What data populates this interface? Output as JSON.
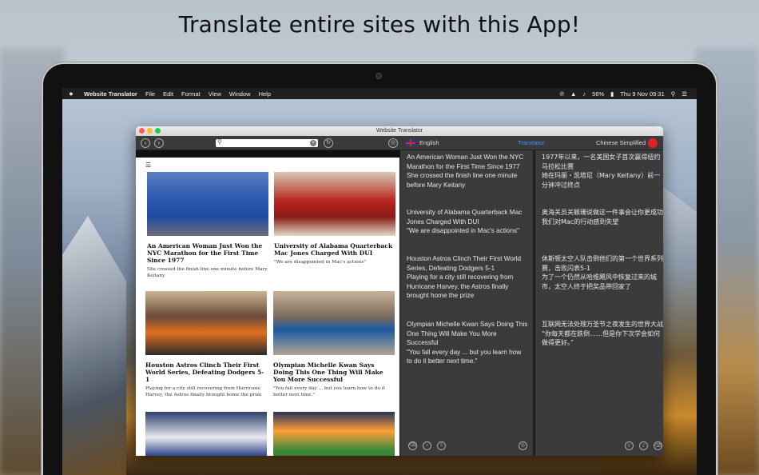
{
  "headline": "Translate entire sites with this App!",
  "menubar": {
    "apple": "",
    "app_name": "Website Translator",
    "items": [
      "File",
      "Edit",
      "Format",
      "View",
      "Window",
      "Help"
    ],
    "battery": "56%",
    "datetime": "Thu 9 Nov  09:31"
  },
  "window": {
    "title": "Website Translator",
    "source_language": "English",
    "translator_label": "Translator",
    "target_language": "Chinese Simplified",
    "search_placeholder": ""
  },
  "browser": {
    "articles": [
      {
        "title": "An American Woman Just Won the NYC Marathon for the First Time Since 1977",
        "snippet": "She crossed the finish line one minute before Mary Keitany"
      },
      {
        "title": "University of Alabama Quarterback Mac Jones Charged With DUI",
        "snippet": "\"We are disappointed in Mac's actions\""
      },
      {
        "title": "Houston Astros Clinch Their First World Series, Defeating Dodgers 5-1",
        "snippet": "Playing for a city still recovering from Hurricane Harvey, the Astros finally brought home the prize"
      },
      {
        "title": "Olympian Michelle Kwan Says Doing This One Thing Will Make You More Successful",
        "snippet": "\"You fall every day ... but you learn how to do it better next time.\""
      }
    ]
  },
  "source_pane": {
    "paragraphs": [
      "An American Woman Just Won the NYC Marathon for the First Time Since 1977\nShe crossed the finish line one minute before Mary Keitany",
      "University of Alabama Quarterback Mac Jones Charged With DUI\n\"We are disappointed in Mac's actions\"",
      "Houston Astros Clinch Their First World Series, Defeating Dodgers 5-1\nPlaying for a city still recovering from Hurricane Harvey, the Astros finally brought home the prize",
      "Olympian Michelle Kwan Says Doing This One Thing Will Make You More Successful\n\"You fall every day ... but you learn how to do it better next time.\""
    ]
  },
  "target_pane": {
    "paragraphs": [
      "1977年以来，一名美国女子首次赢得纽约马拉松比赛\n她在玛丽・凯塔尼（Mary Keitany）前一分钟冲过终点",
      "奥海关员关颖珊说做这一件事会让你更成功\n我们对Mac的行动感到失望",
      "休斯顿太空人队击倒他们的第一个世界系列赛，击败闪表5-1\n为了一个仍然从哈维飓风中恢复过来的城市，太空人终于把奖品带回家了",
      "互联网无法处理万圣节之夜发生的世界大战\n“你每天都在跌倒……但是你下次学会如何做得更好。”"
    ]
  },
  "icons": {
    "back": "back-arrow-icon",
    "forward": "forward-arrow-icon",
    "search": "search-icon",
    "reload": "reload-icon",
    "translate": "translate-icon",
    "trash": "trash-icon",
    "speak": "speaker-icon",
    "share": "share-icon",
    "web": "globe-icon"
  }
}
